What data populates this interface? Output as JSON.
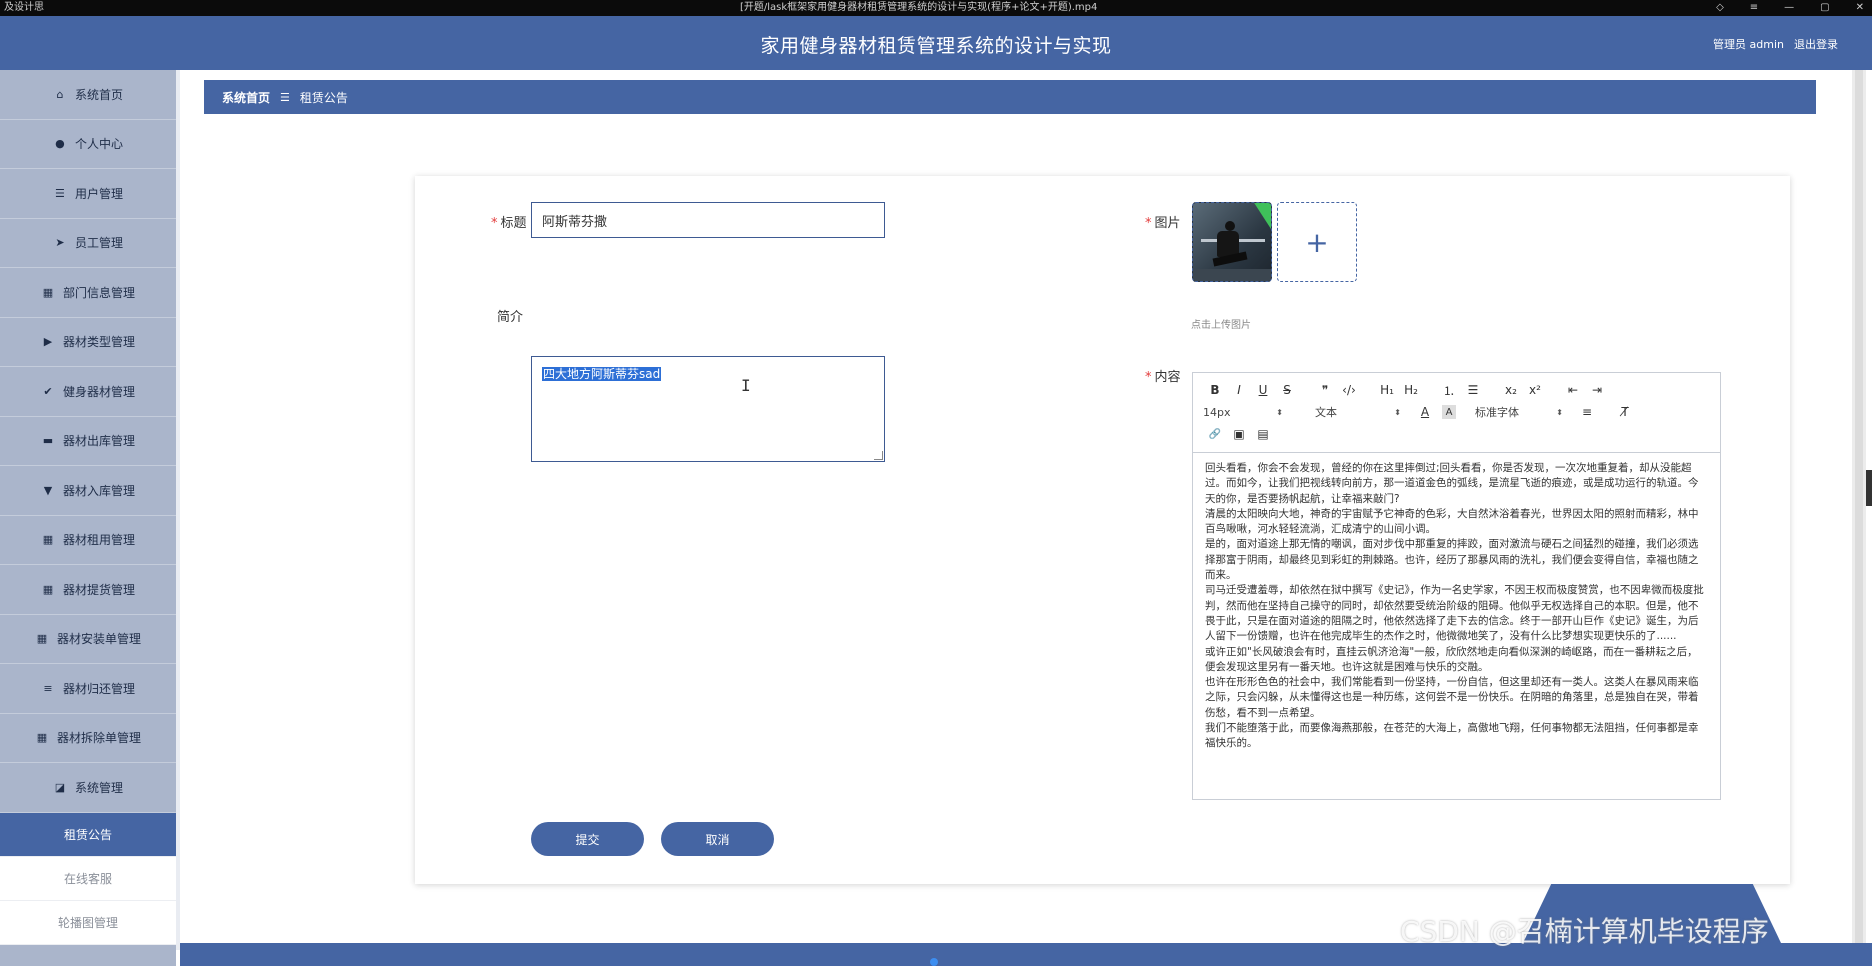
{
  "window": {
    "title": "[开题/lask框架家用健身器材租赁管理系统的设计与实现(程序+论文+开题).mp4",
    "left_text": "及设计思",
    "controls": [
      "◇",
      "≡",
      "—",
      "▢",
      "✕"
    ]
  },
  "header": {
    "title": "家用健身器材租赁管理系统的设计与实现",
    "user_label": "管理员 admin",
    "logout_label": "退出登录"
  },
  "sidebar": {
    "items": [
      {
        "label": "系统首页",
        "icon": "home-icon",
        "glyph": "⌂"
      },
      {
        "label": "个人中心",
        "icon": "user-icon",
        "glyph": "●"
      },
      {
        "label": "用户管理",
        "icon": "list-icon",
        "glyph": "☰"
      },
      {
        "label": "员工管理",
        "icon": "send-icon",
        "glyph": "➤"
      },
      {
        "label": "部门信息管理",
        "icon": "grid-icon",
        "glyph": "▦"
      },
      {
        "label": "器材类型管理",
        "icon": "video-icon",
        "glyph": "▶"
      },
      {
        "label": "健身器材管理",
        "icon": "clipboard-icon",
        "glyph": "✔"
      },
      {
        "label": "器材出库管理",
        "icon": "briefcase-icon",
        "glyph": "▬"
      },
      {
        "label": "器材入库管理",
        "icon": "stamp-icon",
        "glyph": "▼"
      },
      {
        "label": "器材租用管理",
        "icon": "grid-icon",
        "glyph": "▦"
      },
      {
        "label": "器材提货管理",
        "icon": "grid-icon",
        "glyph": "▦"
      },
      {
        "label": "器材安装单管理",
        "icon": "grid-icon",
        "glyph": "▦"
      },
      {
        "label": "器材归还管理",
        "icon": "sliders-icon",
        "glyph": "≡"
      },
      {
        "label": "器材拆除单管理",
        "icon": "grid-icon",
        "glyph": "▦"
      },
      {
        "label": "系统管理",
        "icon": "chart-icon",
        "glyph": "◪"
      }
    ],
    "sub_items": [
      {
        "label": "租赁公告",
        "active": true
      },
      {
        "label": "在线客服",
        "active": false
      },
      {
        "label": "轮播图管理",
        "active": false
      }
    ]
  },
  "breadcrumb": {
    "home": "系统首页",
    "separator": "☰",
    "current": "租赁公告"
  },
  "form": {
    "title_label": "标题",
    "title_value": "阿斯蒂芬撒",
    "image_label": "图片",
    "upload_hint": "点击上传图片",
    "intro_label": "简介",
    "intro_value": "四大地方阿斯蒂芬sad",
    "content_label": "内容",
    "required_mark": "*",
    "submit_label": "提交",
    "cancel_label": "取消"
  },
  "editor": {
    "font_size": "14px",
    "text_type": "文本",
    "font_family": "标准字体",
    "toolbar": {
      "bold": "B",
      "italic": "I",
      "underline": "U",
      "strike": "S",
      "quote": "❞",
      "code": "‹/›",
      "h1": "H₁",
      "h2": "H₂",
      "ordered_list": "⒈",
      "bullet_list": "☰",
      "subscript": "x₂",
      "superscript": "x²",
      "outdent": "⇤",
      "indent": "⇥",
      "color": "A",
      "background": "A",
      "align": "≡",
      "clear": "T̸",
      "link": "🔗",
      "image": "▣",
      "video": "▤"
    },
    "paragraphs": [
      "回头看看，你会不会发现，曾经的你在这里摔倒过;回头看看，你是否发现，一次次地重复着，却从没能超过。而如今，让我们把视线转向前方，那一道道金色的弧线，是流星飞逝的痕迹，或是成功运行的轨道。今天的你，是否要扬帆起航，让幸福来敲门?",
      "清晨的太阳映向大地，神奇的宇宙赋予它神奇的色彩，大自然沐浴着春光，世界因太阳的照射而精彩，林中百鸟啾啾，河水轻轻流淌，汇成清宁的山间小调。",
      "是的，面对道途上那无情的嘲讽，面对步伐中那重复的摔跤，面对激流与硬石之间猛烈的碰撞，我们必须选择那富于阴雨，却最终见到彩虹的荆棘路。也许，经历了那暴风雨的洗礼，我们便会变得自信，幸福也随之而来。",
      "司马迁受遭羞辱，却依然在狱中撰写《史记》，作为一名史学家，不因王权而极度赞赏，也不因卑微而极度批判，然而他在坚持自己操守的同时，却依然要受统治阶级的阻碍。他似乎无权选择自己的本职。但是，他不畏于此，只是在面对道途的阻隔之时，他依然选择了走下去的信念。终于一部开山巨作《史记》诞生，为后人留下一份馈赠，也许在他完成毕生的杰作之时，他微微地笑了，没有什么比梦想实现更快乐的了......",
      "或许正如\"长风破浪会有时，直挂云帆济沧海\"一般，欣欣然地走向看似深渊的崎岖路，而在一番耕耘之后，便会发现这里另有一番天地。也许这就是困难与快乐的交融。",
      "也许在形形色色的社会中，我们常能看到一份坚持，一份自信，但这里却还有一类人。这类人在暴风雨来临之际，只会闪躲，从未懂得这也是一种历练，这何尝不是一份快乐。在阴暗的角落里，总是独自在哭，带着伤愁，看不到一点希望。",
      "我们不能堕落于此，而要像海燕那般，在苍茫的大海上，高傲地飞翔，任何事物都无法阻挡，任何事都是幸福快乐的。"
    ]
  },
  "watermark": "CSDN @召楠计算机毕设程序"
}
